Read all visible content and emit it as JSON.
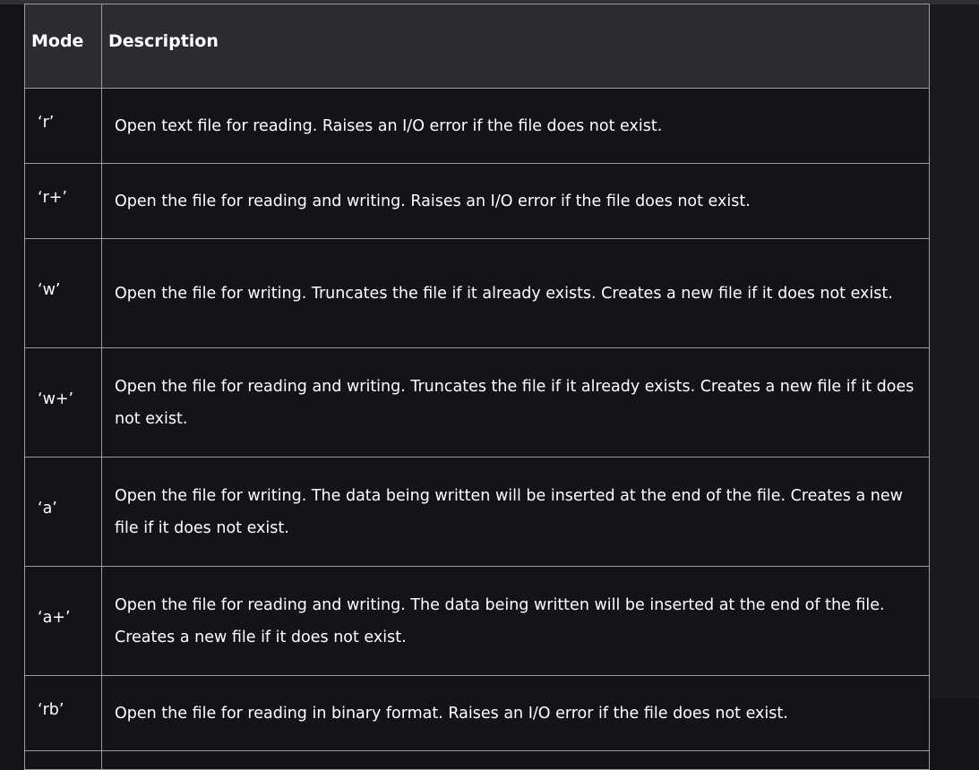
{
  "table": {
    "headers": {
      "mode": "Mode",
      "description": "Description"
    },
    "rows": [
      {
        "mode": "‘r’",
        "description": "Open text file for reading. Raises an I/O error if the file does not exist."
      },
      {
        "mode": "‘r+’",
        "description": "Open the file for reading and writing. Raises an I/O error if the file does not exist."
      },
      {
        "mode": "‘w’",
        "description": "Open the file for writing. Truncates the file if it already exists. Creates a new file if it does not exist."
      },
      {
        "mode": "‘w+’",
        "description": "Open the file for reading and writing. Truncates the file if it already exists. Creates a new file if it does not exist."
      },
      {
        "mode": "‘a’",
        "description": "Open the file for writing. The data being written will be inserted at the end of the file. Creates a new file if it does not exist."
      },
      {
        "mode": "‘a+’",
        "description": "Open the file for reading and writing. The data being written will be inserted at the end of the file. Creates a new file if it does not exist."
      },
      {
        "mode": "‘rb’",
        "description": "Open the file for reading in binary format. Raises an I/O error if the file does not exist."
      }
    ]
  },
  "colors": {
    "page_background": "#131417",
    "header_background": "#2b2c30",
    "border": "#9a9b9e",
    "text": "#ffffff"
  }
}
